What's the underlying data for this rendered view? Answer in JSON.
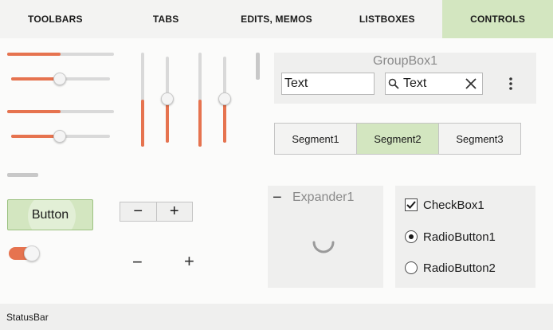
{
  "tabs": [
    {
      "label": "TOOLBARS",
      "active": false
    },
    {
      "label": "TABS",
      "active": false
    },
    {
      "label": "EDITS, MEMOS",
      "active": false
    },
    {
      "label": "LISTBOXES",
      "active": false
    },
    {
      "label": "CONTROLS",
      "active": true
    }
  ],
  "sliders": {
    "h1_progress": 0.5,
    "h2_thumb": 0.5,
    "h3_progress": 0.5,
    "h4_thumb": 0.5,
    "v1_progress": 0.5,
    "v2_thumb": 0.5,
    "v3_progress": 0.5,
    "v4_thumb": 0.5
  },
  "groupbox": {
    "title": "GroupBox1",
    "edit_value": "Text",
    "search_value": "Text",
    "icons": {
      "search": "search-icon",
      "clear": "close-icon",
      "more": "more-vertical-icon"
    }
  },
  "segments": [
    {
      "label": "Segment1",
      "selected": false
    },
    {
      "label": "Segment2",
      "selected": true
    },
    {
      "label": "Segment3",
      "selected": false
    }
  ],
  "button": {
    "label": "Button"
  },
  "stepper": {
    "minus": "−",
    "plus": "+"
  },
  "standalone_stepper": {
    "minus": "−",
    "plus": "+"
  },
  "toggle": {
    "on": true
  },
  "expander": {
    "title": "Expander1",
    "collapse_glyph": "−"
  },
  "checkbox": {
    "label": "CheckBox1",
    "checked": true
  },
  "radios": [
    {
      "label": "RadioButton1",
      "checked": true
    },
    {
      "label": "RadioButton2",
      "checked": false
    }
  ],
  "statusbar": {
    "text": "StatusBar"
  },
  "colors": {
    "accent": "#e6734f",
    "selected": "#d3e6c0"
  }
}
